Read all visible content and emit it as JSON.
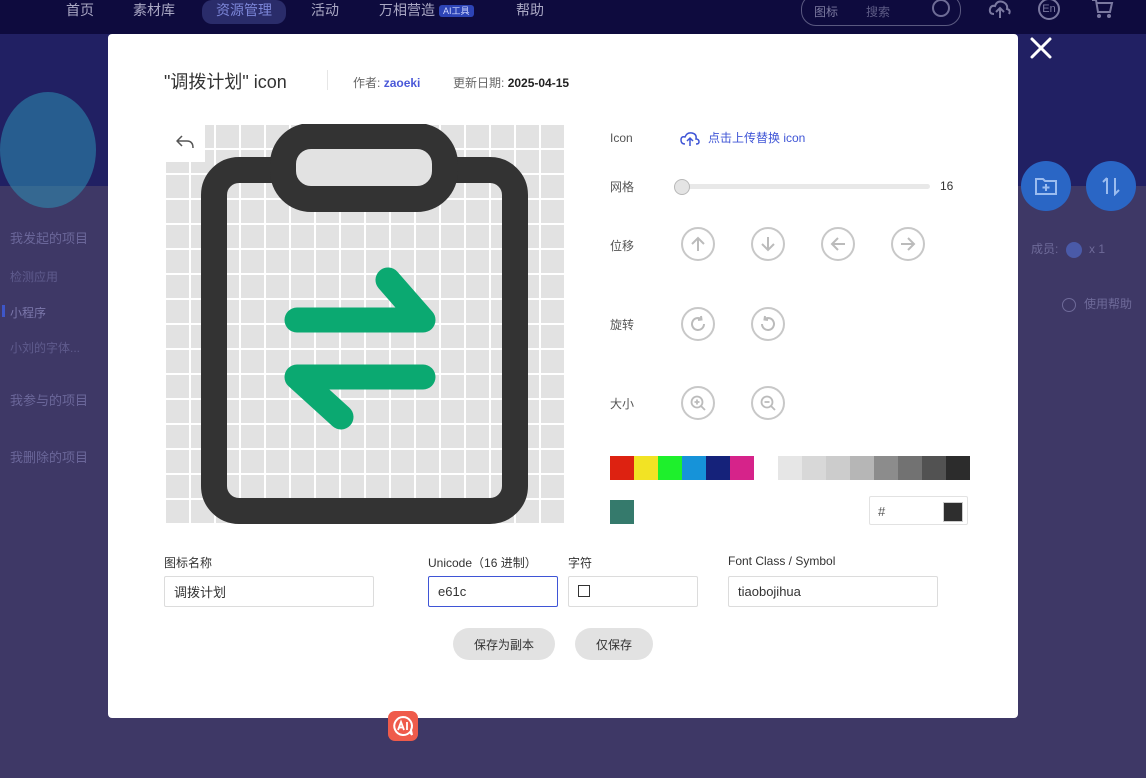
{
  "nav": {
    "items": [
      "首页",
      "素材库",
      "资源管理",
      "活动",
      "万相营造",
      "帮助"
    ],
    "ai_badge": "AI工具",
    "search_type": "图标",
    "search_placeholder": "搜索",
    "lang_label": "En"
  },
  "sidebar": {
    "items": [
      "我发起的项目",
      "检测应用",
      "小程序",
      "小刘的字体...",
      "我参与的项目",
      "我删除的项目"
    ]
  },
  "right_panel": {
    "members_label": "成员:",
    "members_count": "x 1",
    "help_label": "使用帮助"
  },
  "modal": {
    "title": "\"调拨计划\" icon",
    "author_label": "作者:",
    "author": "zaoeki",
    "date_label": "更新日期:",
    "date": "2025-04-15",
    "controls": {
      "icon_label": "Icon",
      "upload_link": "点击上传替换 icon",
      "grid_label": "网格",
      "grid_value": "16",
      "grid_fraction": 0.0,
      "move_label": "位移",
      "rotate_label": "旋转",
      "size_label": "大小"
    },
    "palette": [
      "#dd2211",
      "#f2e324",
      "#1ef02c",
      "#1693d9",
      "#15227a",
      "#d6238a",
      "#e6e6e6",
      "#d8d8d8",
      "#cccccc",
      "#b6b6b6",
      "#8c8c8c",
      "#727272",
      "#525252",
      "#2c2c2c"
    ],
    "current_color": "#357a6c",
    "hex_prefix": "#",
    "hex_value_color": "#2e2e2e",
    "icon_colors": {
      "outline": "#333333",
      "arrows": "#0ba971"
    },
    "fields": {
      "name_label": "图标名称",
      "name_value": "调拨计划",
      "unicode_label": "Unicode（16 进制）",
      "unicode_value": "e61c",
      "char_label": "字符",
      "fontclass_label": "Font Class / Symbol",
      "fontclass_value": "tiaobojihua"
    },
    "buttons": {
      "save_copy": "保存为副本",
      "save_only": "仅保存"
    }
  }
}
